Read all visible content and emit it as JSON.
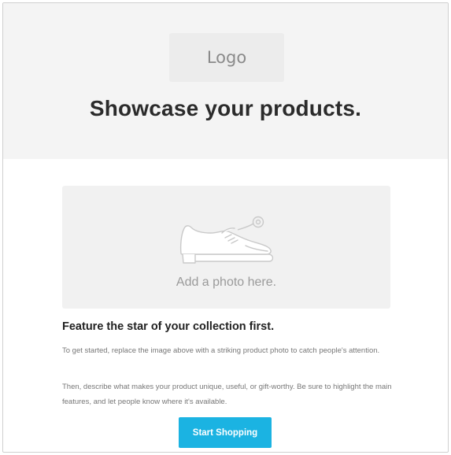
{
  "header": {
    "logo_text": "Logo",
    "headline": "Showcase your products."
  },
  "hero": {
    "placeholder_text": "Add a photo here.",
    "icon": "shoe-icon"
  },
  "feature": {
    "title": "Feature the star of your collection first.",
    "paragraph_1": "To get started, replace the image above with a striking product photo to catch people's attention.",
    "paragraph_2": "Then, describe what makes your product unique, useful, or gift-worthy. Be sure to highlight the main features, and let people know where it's available."
  },
  "cta": {
    "label": "Start Shopping"
  },
  "colors": {
    "header_bg": "#f4f4f4",
    "placeholder_bg": "#f1f1f1",
    "button_bg": "#1bb3e2",
    "button_text": "#ffffff",
    "headline_text": "#2b2b2b",
    "body_text": "#777777"
  }
}
